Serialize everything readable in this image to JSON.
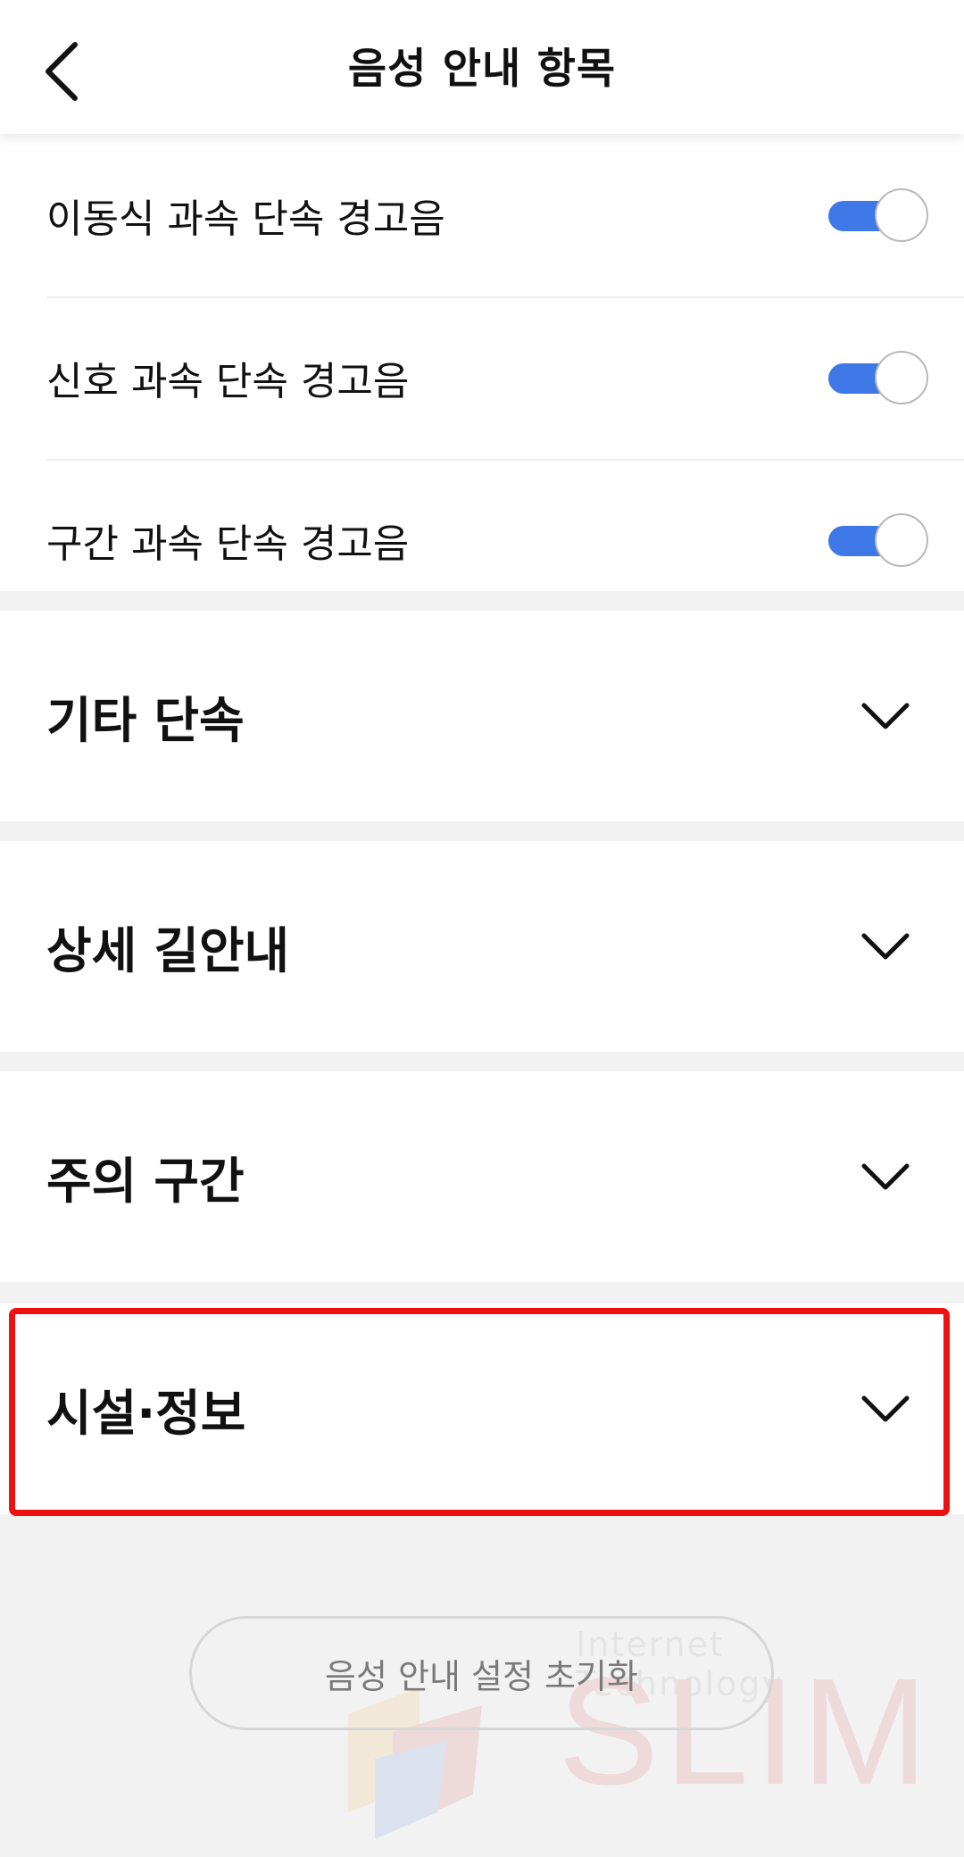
{
  "header": {
    "title": "음성 안내 항목"
  },
  "toggles": [
    {
      "label": "이동식 과속 단속 경고음",
      "on": true
    },
    {
      "label": "신호 과속 단속 경고음",
      "on": true
    },
    {
      "label": "구간 과속 단속 경고음",
      "on": true
    }
  ],
  "sections": [
    {
      "title": "기타 단속"
    },
    {
      "title": "상세 길안내"
    },
    {
      "title": "주의 구간"
    },
    {
      "title": "시설·정보"
    }
  ],
  "reset_button": "음성 안내 설정 초기화",
  "watermark": {
    "subtitle": "Internet Technology",
    "brand": "SLIM"
  },
  "colors": {
    "accent": "#3d78e6",
    "highlight": "#ee1111",
    "background": "#f2f2f2"
  }
}
